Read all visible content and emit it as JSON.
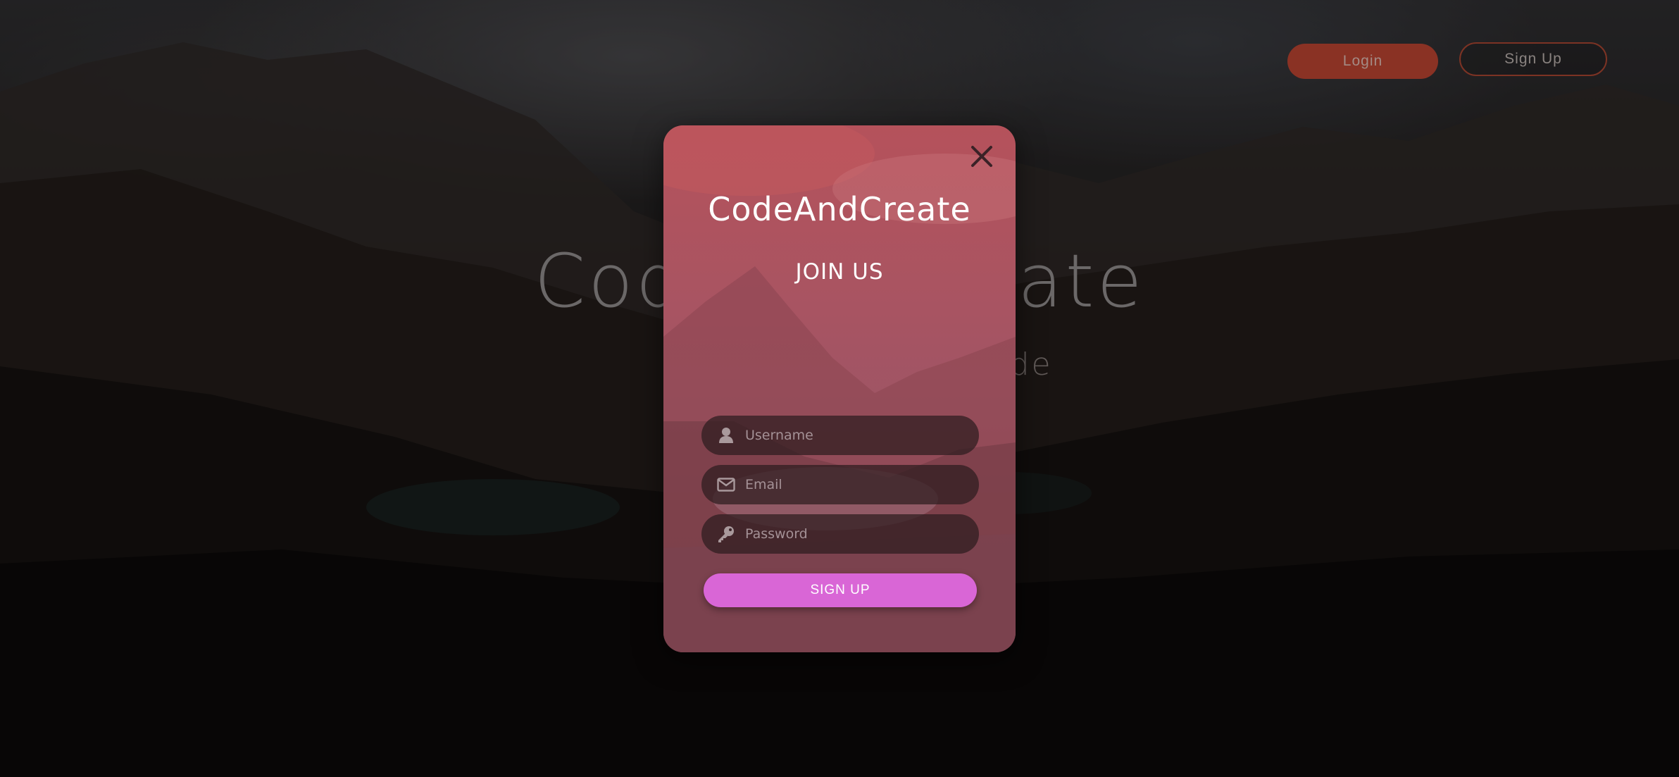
{
  "header": {
    "login_label": "Login",
    "signup_label": "Sign Up"
  },
  "hero": {
    "title": "CodeAndCreate",
    "subtitle_visible": "to code"
  },
  "modal": {
    "brand": "CodeAndCreate",
    "heading": "JOIN US",
    "close_icon": "close-icon",
    "fields": {
      "username": {
        "placeholder": "Username",
        "value": "",
        "icon": "user-icon"
      },
      "email": {
        "placeholder": "Email",
        "value": "",
        "icon": "envelope-icon"
      },
      "password": {
        "placeholder": "Password",
        "value": "",
        "icon": "key-icon"
      }
    },
    "submit_label": "SIGN UP"
  },
  "colors": {
    "login_button": "#8a3224",
    "signup_outline": "#7c3324",
    "modal_tint": "#b5525b",
    "submit_button": "#d966d6"
  }
}
